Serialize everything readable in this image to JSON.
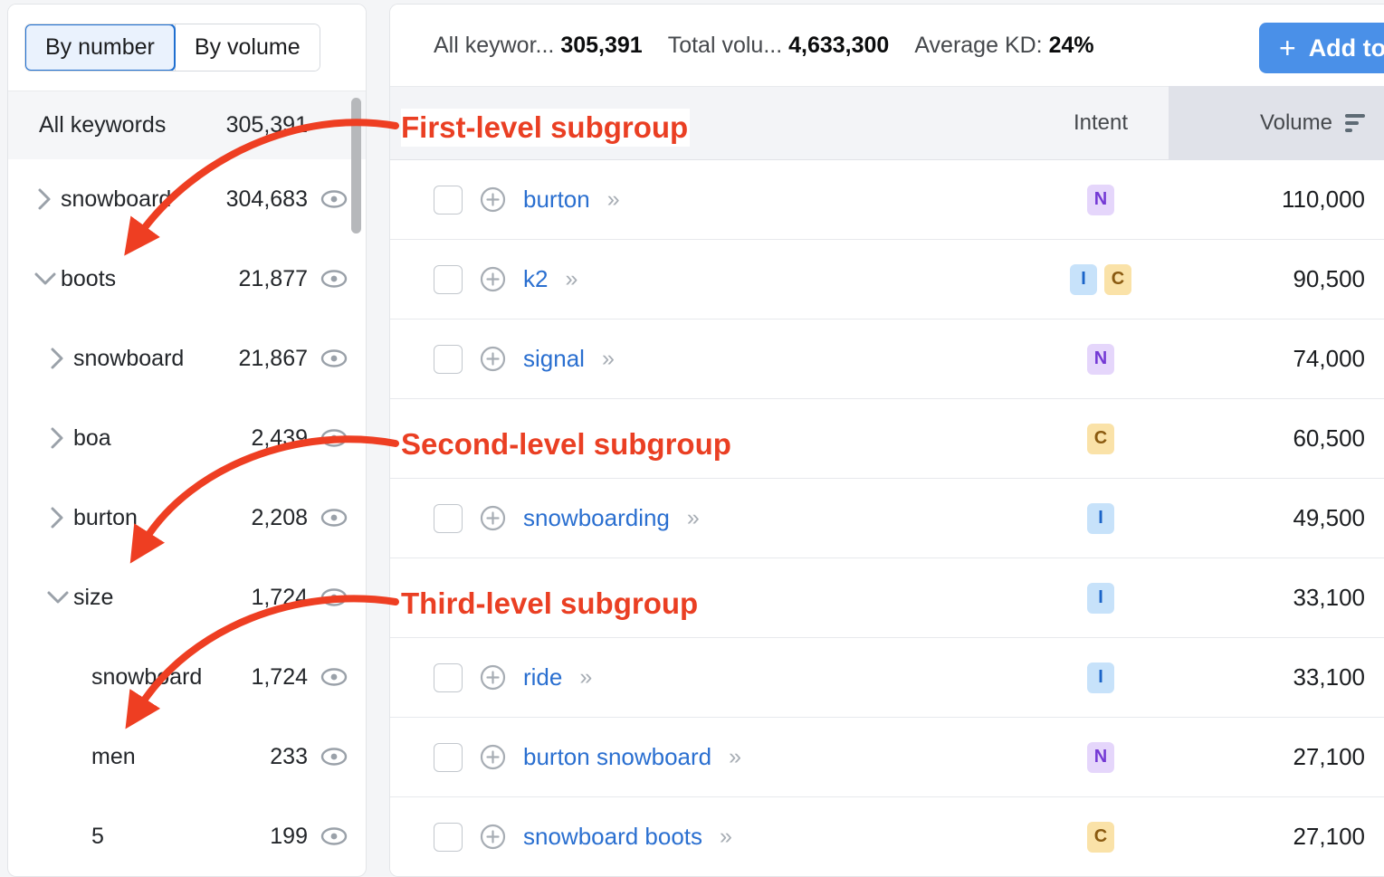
{
  "sidebar": {
    "segmented": {
      "options": [
        {
          "label": "By number",
          "active": true
        },
        {
          "label": "By volume",
          "active": false
        }
      ]
    },
    "header_row": {
      "label": "All keywords",
      "count": "305,391"
    },
    "items": [
      {
        "label": "snowboard",
        "count": "304,683",
        "indent": 0,
        "state": "collapsed",
        "eye": true
      },
      {
        "label": "boots",
        "count": "21,877",
        "indent": 0,
        "state": "expanded",
        "eye": true
      },
      {
        "label": "snowboard",
        "count": "21,867",
        "indent": 1,
        "state": "collapsed",
        "eye": true
      },
      {
        "label": "boa",
        "count": "2,439",
        "indent": 1,
        "state": "collapsed",
        "eye": true
      },
      {
        "label": "burton",
        "count": "2,208",
        "indent": 1,
        "state": "collapsed",
        "eye": true
      },
      {
        "label": "size",
        "count": "1,724",
        "indent": 1,
        "state": "expanded",
        "eye": true
      },
      {
        "label": "snowboard",
        "count": "1,724",
        "indent": 2,
        "state": "leaf",
        "eye": true
      },
      {
        "label": "men",
        "count": "233",
        "indent": 2,
        "state": "leaf",
        "eye": true
      },
      {
        "label": "5",
        "count": "199",
        "indent": 2,
        "state": "leaf",
        "eye": true
      }
    ]
  },
  "summary": {
    "metrics": [
      {
        "label": "All keywor...",
        "value": "305,391"
      },
      {
        "label": "Total volu...",
        "value": "4,633,300"
      },
      {
        "label": "Average KD:",
        "value": "24%"
      }
    ],
    "add_to_button": {
      "icon": "plus",
      "label": "Add to"
    }
  },
  "table": {
    "columns": {
      "keyword": "",
      "intent": "Intent",
      "volume": "Volume",
      "sort_icon": "sort-descending-icon"
    },
    "rows": [
      {
        "keyword": "burton",
        "intents": [
          "N"
        ],
        "volume": "110,000",
        "hidden_by_annotation": false
      },
      {
        "keyword": "k2",
        "intents": [
          "I",
          "C"
        ],
        "volume": "90,500",
        "hidden_by_annotation": false
      },
      {
        "keyword": "signal",
        "intents": [
          "N"
        ],
        "volume": "74,000",
        "hidden_by_annotation": false
      },
      {
        "keyword": "",
        "intents": [
          "C"
        ],
        "volume": "60,500",
        "hidden_by_annotation": true
      },
      {
        "keyword": "snowboarding",
        "intents": [
          "I"
        ],
        "volume": "49,500",
        "hidden_by_annotation": false
      },
      {
        "keyword": "",
        "intents": [
          "I"
        ],
        "volume": "33,100",
        "hidden_by_annotation": true
      },
      {
        "keyword": "ride",
        "intents": [
          "I"
        ],
        "volume": "33,100",
        "hidden_by_annotation": false
      },
      {
        "keyword": "burton snowboard",
        "intents": [
          "N"
        ],
        "volume": "27,100",
        "hidden_by_annotation": false
      },
      {
        "keyword": "snowboard boots",
        "intents": [
          "C"
        ],
        "volume": "27,100",
        "hidden_by_annotation": false
      }
    ]
  },
  "annotations": {
    "color": "#ea3f23",
    "labels": [
      {
        "id": "anno-1",
        "text": "First-level subgroup"
      },
      {
        "id": "anno-2",
        "text": "Second-level subgroup"
      },
      {
        "id": "anno-3",
        "text": "Third-level subgroup"
      }
    ],
    "arrows": 3
  }
}
